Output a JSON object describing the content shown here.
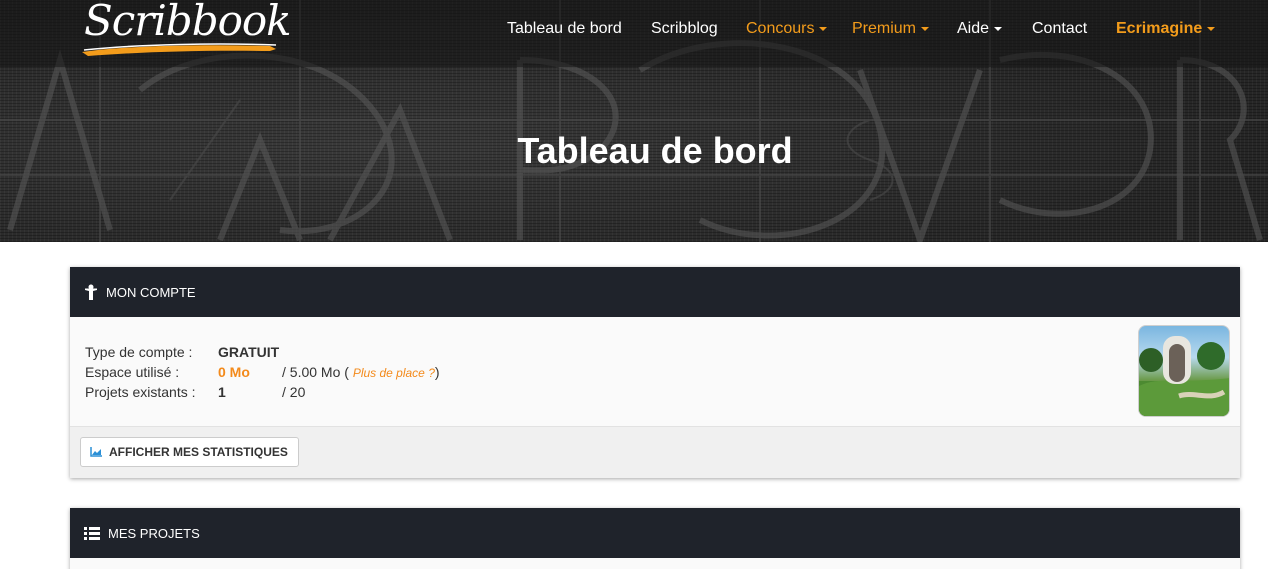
{
  "brand": {
    "name": "Scribbook"
  },
  "nav": [
    {
      "label": "Tableau de bord"
    },
    {
      "label": "Scribblog"
    },
    {
      "label": "Concours"
    },
    {
      "label": "Premium"
    },
    {
      "label": "Aide"
    },
    {
      "label": "Contact"
    },
    {
      "label": "Ecrimagine"
    }
  ],
  "page_title": "Tableau de bord",
  "account": {
    "title": "MON COMPTE",
    "type_label": "Type de compte :",
    "type_value": "GRATUIT",
    "space_label": "Espace utilisé :",
    "space_value": "0 Mo",
    "space_total_prefix": "/ 5.00 Mo (",
    "more_space_link": "Plus de place ?",
    "space_total_suffix": ")",
    "projects_label": "Projets existants :",
    "projects_value": "1",
    "projects_total": "/ 20",
    "stats_button": "AFFICHER MES STATISTIQUES"
  },
  "projects": {
    "title": "MES PROJETS"
  },
  "colors": {
    "accent": "#f39c1b",
    "panel_header": "#1f232b",
    "hero": "#2c2c2c"
  },
  "icons": [
    "person-icon",
    "chart-icon",
    "list-icon",
    "caret-down-icon"
  ]
}
